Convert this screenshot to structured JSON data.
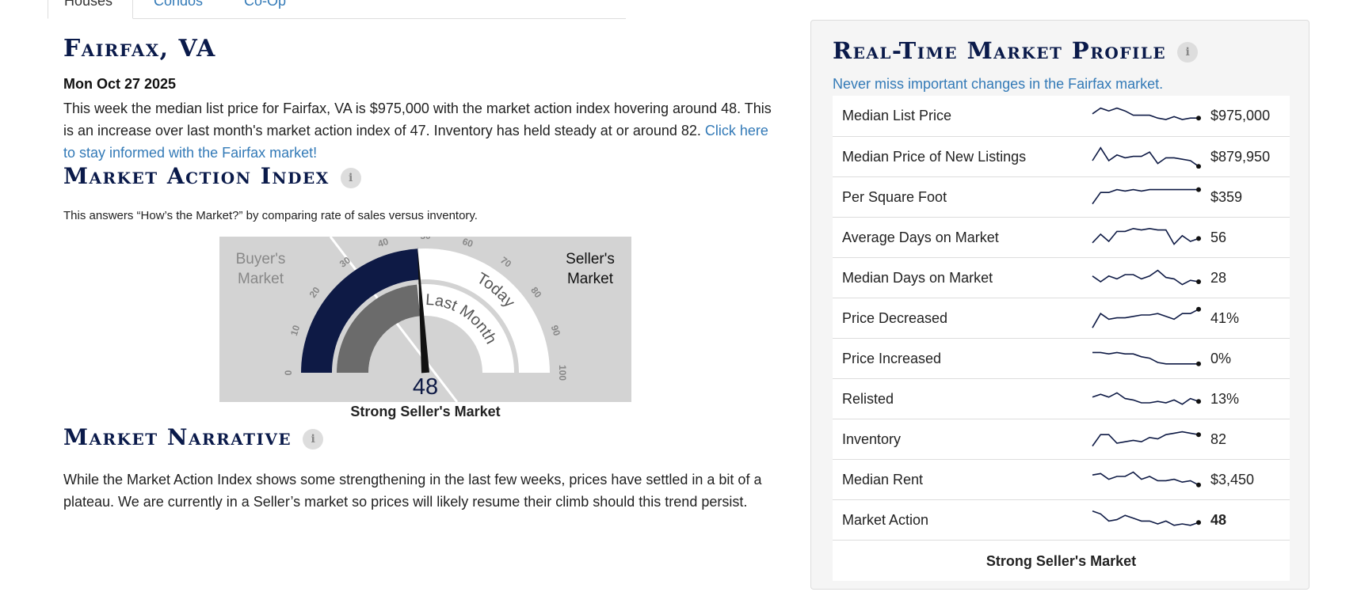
{
  "tabs": [
    "Houses",
    "Condos",
    "Co-Op"
  ],
  "location": "Fairfax, VA",
  "date": "Mon Oct 27 2025",
  "summary": {
    "text": "This week the median list price for Fairfax, VA is $975,000 with the market action index hovering around 48. This is an increase over last month's market action index of 47. Inventory has held steady at or around 82.",
    "link": "Click here to stay informed with the Fairfax market!"
  },
  "market_action": {
    "title": "Market Action Index",
    "subtitle": "This answers “How’s the Market?” by comparing rate of sales versus inventory.",
    "gauge": {
      "today_value": 48,
      "last_month_value": 47,
      "min": 0,
      "max": 100,
      "ticks": [
        "0",
        "10",
        "20",
        "30",
        "40",
        "50",
        "60",
        "70",
        "80",
        "90",
        "100"
      ],
      "buyers_label_line1": "Buyer's",
      "buyers_label_line2": "Market",
      "sellers_label_line1": "Seller's",
      "sellers_label_line2": "Market",
      "last_month_label": "Last Month",
      "today_label": "Today",
      "value_text": "48",
      "colors": {
        "today": "#0e1a45",
        "last_month": "#6b6b6b",
        "track": "#ffffff",
        "background": "#d3d3d3"
      }
    },
    "caption": "Strong Seller's Market"
  },
  "narrative": {
    "title": "Market Narrative",
    "text": "While the Market Action Index shows some strengthening in the last few weeks, prices have settled in a bit of a plateau. We are currently in a Seller’s market so prices will likely resume their climb should this trend persist."
  },
  "profile": {
    "title": "Real-Time Market Profile",
    "subtitle": "Never miss important changes in the Fairfax market.",
    "rows": [
      {
        "label": "Median List Price",
        "value": "$975,000",
        "spark": [
          6,
          2,
          4,
          2,
          4,
          7,
          7,
          7,
          9,
          10,
          8,
          10,
          9,
          9
        ]
      },
      {
        "label": "Median Price of New Listings",
        "value": "$879,950",
        "spark": [
          10,
          1,
          10,
          6,
          8,
          7,
          7,
          4,
          12,
          8,
          8,
          9,
          10,
          14
        ]
      },
      {
        "label": "Per Square Foot",
        "value": "$359",
        "spark": [
          12,
          4,
          4,
          2,
          3,
          2,
          3,
          2,
          2,
          2,
          2,
          2,
          2,
          2
        ]
      },
      {
        "label": "Average Days on Market",
        "value": "56",
        "spark": [
          11,
          5,
          10,
          3,
          3,
          1,
          2,
          1,
          2,
          2,
          12,
          6,
          10,
          8
        ]
      },
      {
        "label": "Median Days on Market",
        "value": "28",
        "spark": [
          6,
          10,
          6,
          8,
          5,
          5,
          8,
          6,
          2,
          7,
          8,
          12,
          9,
          10
        ]
      },
      {
        "label": "Price Decreased",
        "value": "41%",
        "spark": [
          14,
          4,
          8,
          7,
          7,
          6,
          5,
          5,
          4,
          6,
          8,
          4,
          4,
          1
        ]
      },
      {
        "label": "Price Increased",
        "value": "0%",
        "spark": [
          3,
          3,
          4,
          3,
          4,
          4,
          6,
          7,
          10,
          11,
          11,
          11,
          11,
          11
        ]
      },
      {
        "label": "Relisted",
        "value": "13%",
        "spark": [
          6,
          4,
          6,
          3,
          7,
          8,
          10,
          10,
          9,
          10,
          8,
          11,
          7,
          9
        ]
      },
      {
        "label": "Inventory",
        "value": "82",
        "spark": [
          12,
          4,
          4,
          10,
          9,
          8,
          9,
          6,
          7,
          4,
          3,
          2,
          3,
          4
        ]
      },
      {
        "label": "Median Rent",
        "value": "$3,450",
        "spark": [
          4,
          3,
          7,
          5,
          5,
          2,
          7,
          5,
          8,
          8,
          7,
          9,
          8,
          11
        ]
      },
      {
        "label": "Market Action",
        "value": "48",
        "spark": [
          1,
          3,
          8,
          7,
          4,
          6,
          8,
          8,
          10,
          8,
          11,
          10,
          11,
          9
        ]
      }
    ],
    "caption": "Strong Seller's Market",
    "spark_color": "#0e1a45"
  }
}
